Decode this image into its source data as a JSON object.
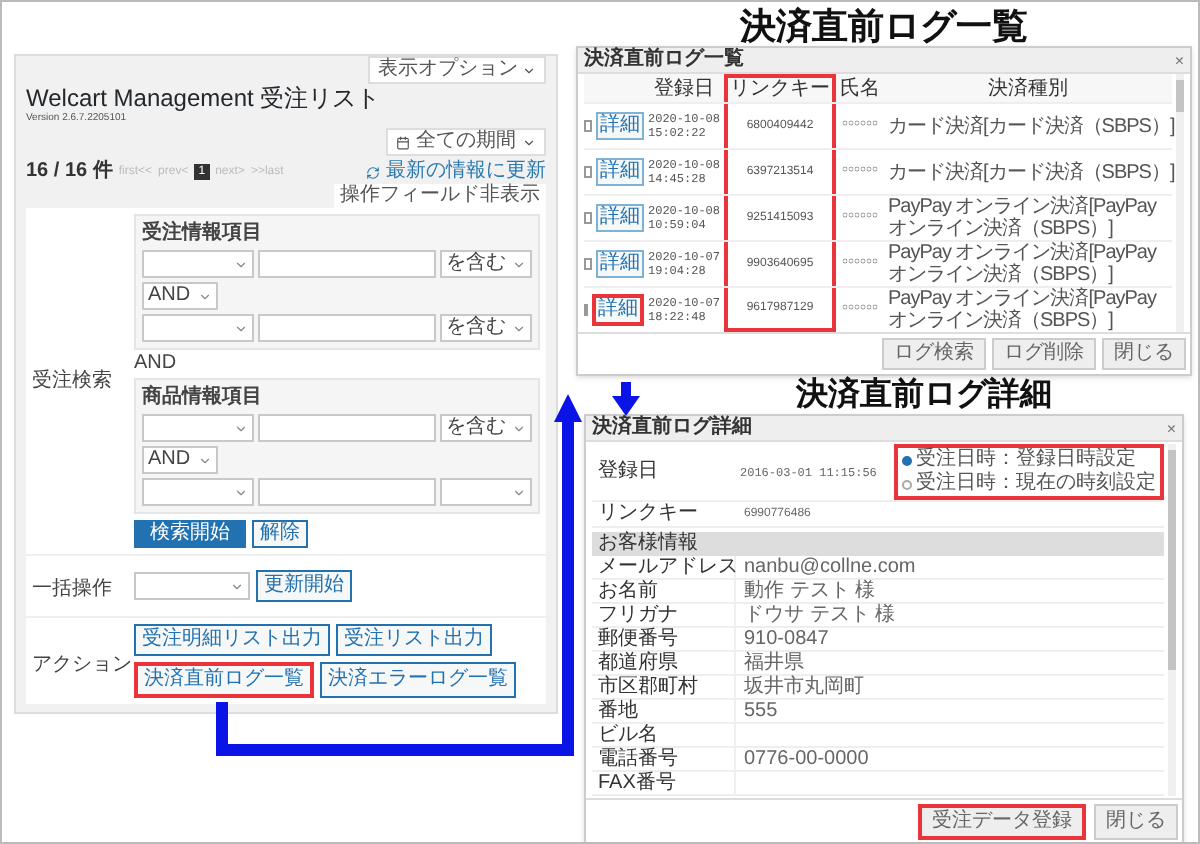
{
  "order_list": {
    "options_button": "表示オプション",
    "title": "Welcart Management 受注リスト",
    "version": "Version 2.6.7.2205101",
    "period_select": "全ての期間",
    "count": "16 / 16 件",
    "pager": [
      {
        "label": "first<<",
        "selected": false
      },
      {
        "label": "prev<",
        "selected": false
      },
      {
        "label": "1",
        "selected": true
      },
      {
        "label": "next>",
        "selected": false
      },
      {
        "label": ">>last",
        "selected": false
      }
    ],
    "refresh_link": "最新の情報に更新",
    "toggle_fields": "操作フィールド非表示",
    "search": {
      "label": "受注検索",
      "groups": [
        {
          "title": "受注情報項目",
          "operator": "AND",
          "rows": [
            {
              "condition": "を含む"
            },
            {
              "condition": "を含む"
            }
          ]
        },
        {
          "title": "商品情報項目",
          "operator": "AND",
          "rows": [
            {
              "condition": "を含む"
            },
            {}
          ]
        }
      ],
      "join": "AND",
      "buttons": [
        {
          "label": "検索開始",
          "kind": "primary"
        },
        {
          "label": "解除",
          "kind": "secondary"
        }
      ]
    },
    "bulk": {
      "label": "一括操作",
      "button": "更新開始"
    },
    "actions": {
      "label": "アクション",
      "buttons": [
        {
          "label": "受注明細リスト出力",
          "highlighted": false
        },
        {
          "label": "受注リスト出力",
          "highlighted": false
        },
        {
          "label": "決済直前ログ一覧",
          "highlighted": true
        },
        {
          "label": "決済エラーログ一覧",
          "highlighted": false
        }
      ]
    }
  },
  "log_list": {
    "heading": "決済直前ログ一覧",
    "title": "決済直前ログ一覧",
    "close": "×",
    "columns": [
      {
        "label": "登録日",
        "highlighted": false
      },
      {
        "label": "リンクキー",
        "highlighted": true
      },
      {
        "label": "氏名",
        "highlighted": false
      },
      {
        "label": "決済種別",
        "highlighted": false
      }
    ],
    "rows": [
      {
        "checked": false,
        "detail_button": "詳細",
        "detail_highlighted": false,
        "date": "2020-10-08",
        "time": "15:02:22",
        "link_key": "6800409442",
        "name": "○○○○○○",
        "payment": [
          "カード決済[カード決済（SBPS）]"
        ]
      },
      {
        "checked": false,
        "detail_button": "詳細",
        "detail_highlighted": false,
        "date": "2020-10-08",
        "time": "14:45:28",
        "link_key": "6397213514",
        "name": "○○○○○○",
        "payment": [
          "カード決済[カード決済（SBPS）]"
        ]
      },
      {
        "checked": false,
        "detail_button": "詳細",
        "detail_highlighted": false,
        "date": "2020-10-08",
        "time": "10:59:04",
        "link_key": "9251415093",
        "name": "○○○○○○",
        "payment": [
          "PayPay オンライン決済[PayPay",
          "オンライン決済（SBPS）]"
        ]
      },
      {
        "checked": false,
        "detail_button": "詳細",
        "detail_highlighted": false,
        "date": "2020-10-07",
        "time": "19:04:28",
        "link_key": "9903640695",
        "name": "○○○○○○",
        "payment": [
          "PayPay オンライン決済[PayPay",
          "オンライン決済（SBPS）]"
        ]
      },
      {
        "checked": false,
        "detail_button": "詳細",
        "detail_highlighted": true,
        "date": "2020-10-07",
        "time": "18:22:48",
        "link_key": "9617987129",
        "name": "○○○○○○",
        "payment": [
          "PayPay オンライン決済[PayPay",
          "オンライン決済（SBPS）]"
        ]
      }
    ],
    "buttons": [
      "ログ検索",
      "ログ削除",
      "閉じる"
    ]
  },
  "log_detail": {
    "heading": "決済直前ログ詳細",
    "title": "決済直前ログ詳細",
    "close": "×",
    "registered": {
      "label": "登録日",
      "value": "2016-03-01 11:15:56",
      "highlighted": true,
      "options": [
        {
          "label": "受注日時：登録日時設定",
          "selected": true
        },
        {
          "label": "受注日時：現在の時刻設定",
          "selected": false
        }
      ]
    },
    "link_key": {
      "label": "リンクキー",
      "value": "6990776486"
    },
    "customer_section": "お客様情報",
    "customer_fields": [
      {
        "label": "メールアドレス",
        "value": "nanbu@collne.com"
      },
      {
        "label": "お名前",
        "value": "動作 テスト 様"
      },
      {
        "label": "フリガナ",
        "value": "ドウサ テスト 様"
      },
      {
        "label": "郵便番号",
        "value": "910-0847"
      },
      {
        "label": "都道府県",
        "value": "福井県"
      },
      {
        "label": "市区郡町村",
        "value": "坂井市丸岡町"
      },
      {
        "label": "番地",
        "value": "555"
      },
      {
        "label": "ビル名"
      },
      {
        "label": "電話番号",
        "value": "0776-00-0000"
      },
      {
        "label": "FAX番号"
      }
    ],
    "buttons": [
      {
        "label": "受注データ登録",
        "highlighted": true
      },
      {
        "label": "閉じる",
        "highlighted": false
      }
    ]
  }
}
